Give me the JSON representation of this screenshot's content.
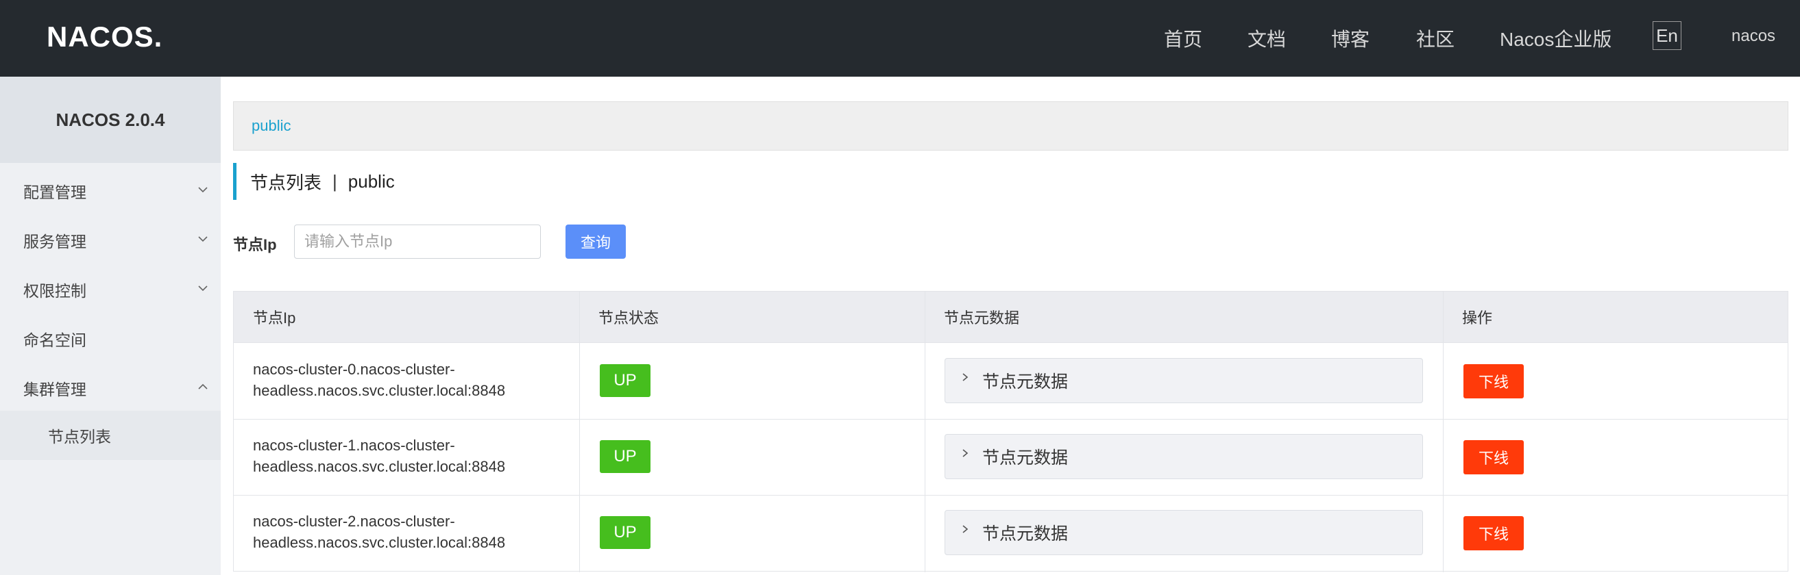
{
  "header": {
    "logo": "NACOS.",
    "nav": [
      "首页",
      "文档",
      "博客",
      "社区",
      "Nacos企业版"
    ],
    "lang": "En",
    "user": "nacos"
  },
  "sidebar": {
    "title": "NACOS 2.0.4",
    "items": [
      {
        "label": "配置管理",
        "expanded": false
      },
      {
        "label": "服务管理",
        "expanded": false
      },
      {
        "label": "权限控制",
        "expanded": false
      },
      {
        "label": "命名空间"
      },
      {
        "label": "集群管理",
        "expanded": true
      }
    ],
    "sub_items": [
      {
        "label": "节点列表"
      }
    ]
  },
  "breadcrumb": "public",
  "page_title": {
    "title": "节点列表",
    "separator": "|",
    "namespace": "public"
  },
  "filter": {
    "label": "节点Ip",
    "placeholder": "请输入节点Ip",
    "value": "",
    "button": "查询"
  },
  "table": {
    "columns": [
      "节点Ip",
      "节点状态",
      "节点元数据",
      "操作"
    ],
    "rows": [
      {
        "ip_line1": "nacos-cluster-0.nacos-cluster-",
        "ip_line2": "headless.nacos.svc.cluster.local:8848",
        "status": "UP",
        "meta": "节点元数据",
        "action": "下线"
      },
      {
        "ip_line1": "nacos-cluster-1.nacos-cluster-",
        "ip_line2": "headless.nacos.svc.cluster.local:8848",
        "status": "UP",
        "meta": "节点元数据",
        "action": "下线"
      },
      {
        "ip_line1": "nacos-cluster-2.nacos-cluster-",
        "ip_line2": "headless.nacos.svc.cluster.local:8848",
        "status": "UP",
        "meta": "节点元数据",
        "action": "下线"
      }
    ]
  },
  "colors": {
    "header_bg": "#252a2f",
    "accent": "#1aa1ce",
    "primary_btn": "#5b8ff9",
    "status_up": "#46be1e",
    "danger": "#ff3a0a"
  },
  "icons": {
    "expand": "chevron-down-icon",
    "collapse": "chevron-up-icon",
    "meta_toggle": "chevron-right-icon"
  }
}
